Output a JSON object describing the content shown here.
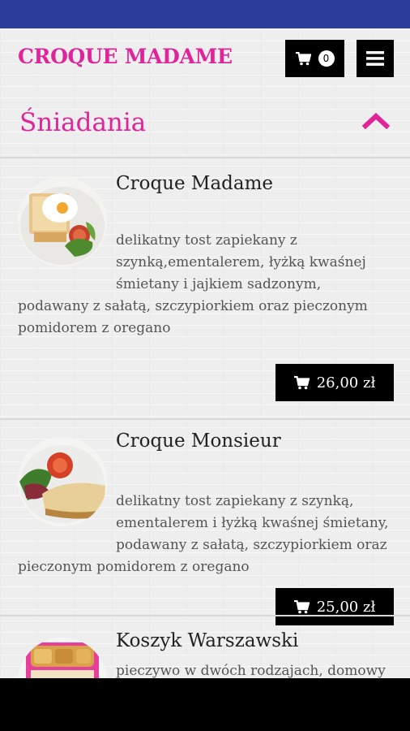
{
  "header": {
    "brand": "CROQUE MADAME",
    "cart_count": "0"
  },
  "section": {
    "title": "Śniadania"
  },
  "products": [
    {
      "name": "Croque Madame",
      "description": "delikatny tost zapiekany z szynką,ementalerem, łyżką kwaśnej śmietany i jajkiem sadzonym, podawany z sałatą, szczypiorkiem oraz pieczonym pomidorem z oregano",
      "price": "26,00 zł"
    },
    {
      "name": "Croque Monsieur",
      "description": "delikatny tost zapiekany z szynką, ementalerem i łyżką kwaśnej śmietany, podawany z sałatą, szczypiorkiem oraz pieczonym pomidorem z oregano",
      "price": "25,00 zł"
    },
    {
      "name": "Koszyk Warszawski",
      "description": "pieczywo w dwóch rodzajach, domowy"
    }
  ],
  "icons": {
    "cart": "cart-icon",
    "menu": "hamburger-menu-icon",
    "collapse": "chevron-up-icon"
  },
  "colors": {
    "status_bar": "#2b3d9a",
    "brand": "#e0249a",
    "button": "#000000"
  }
}
